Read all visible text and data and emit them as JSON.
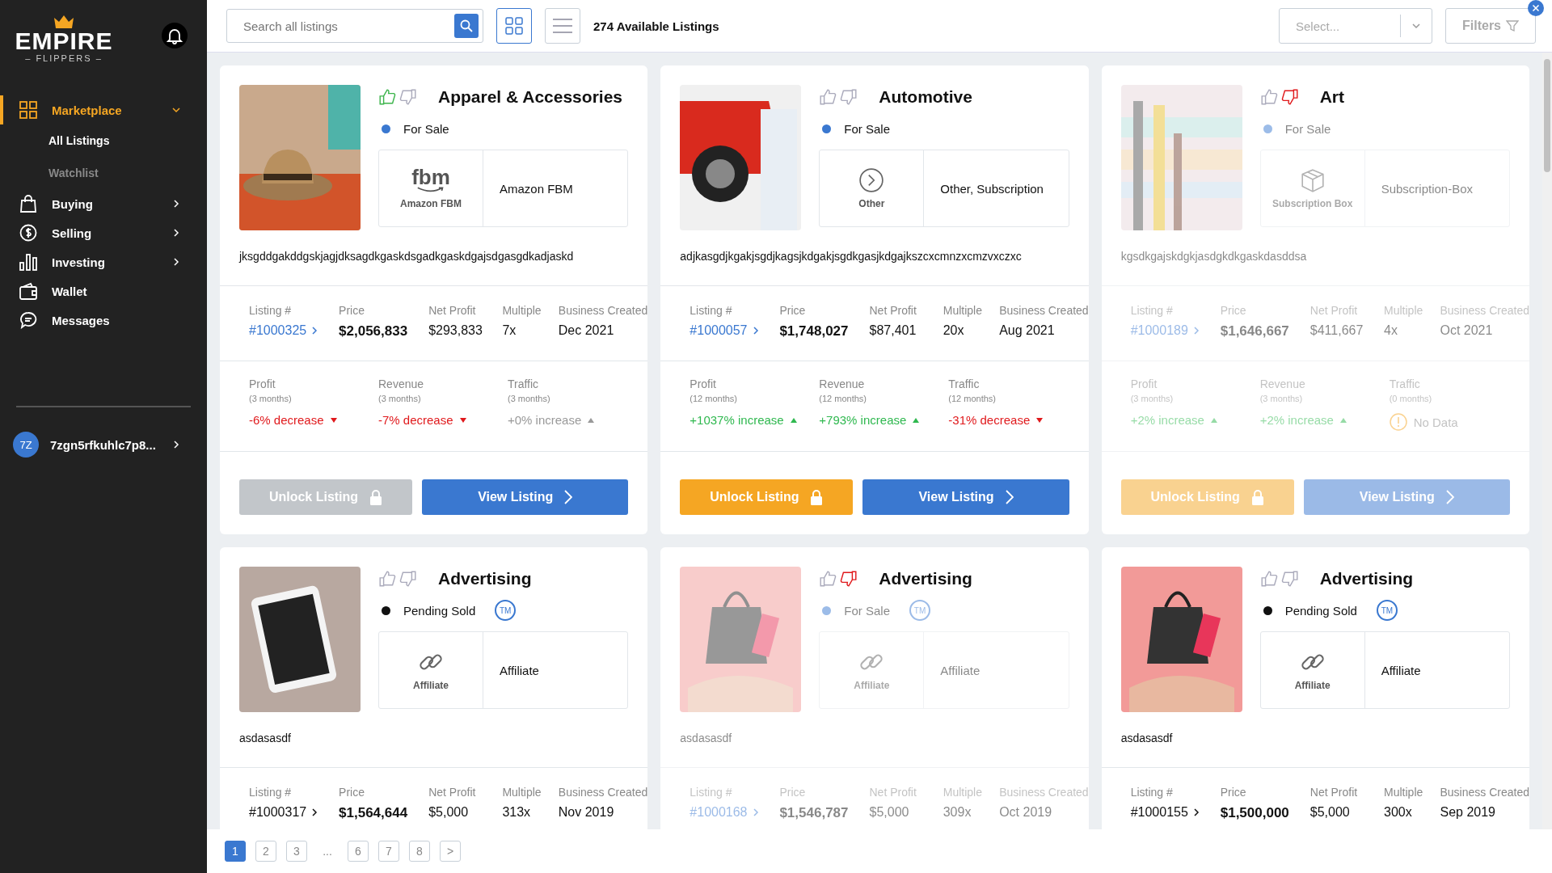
{
  "sidebar": {
    "logo": {
      "word": "EMPIRE",
      "sub": "– FLIPPERS –"
    },
    "nav": [
      {
        "label": "Marketplace",
        "selected": true,
        "expanded": true,
        "children": [
          {
            "label": "All Listings",
            "selected": true
          },
          {
            "label": "Watchlist",
            "selected": false
          }
        ]
      },
      {
        "label": "Buying",
        "selected": false,
        "expanded": false
      },
      {
        "label": "Selling",
        "selected": false,
        "expanded": false
      },
      {
        "label": "Investing",
        "selected": false,
        "expanded": false
      },
      {
        "label": "Wallet",
        "selected": false
      },
      {
        "label": "Messages",
        "selected": false
      }
    ],
    "user": {
      "initials": "7Z",
      "name": "7zgn5rfkuhlc7p8..."
    }
  },
  "toolbar": {
    "search": {
      "placeholder": "Search all listings"
    },
    "views": [
      {
        "kind": "grid",
        "selected": true
      },
      {
        "kind": "list",
        "selected": false
      }
    ],
    "count": "274 Available Listings",
    "select": {
      "placeholder": "Select..."
    },
    "filters": "Filters"
  },
  "listings": [
    {
      "category": "Apparel & Accessories",
      "thumbs_up": true,
      "thumbs_down": false,
      "faded": false,
      "status": {
        "label": "For Sale",
        "color": "#3a78d0"
      },
      "type": {
        "kind": "fbm",
        "logo": "fbm",
        "label": "Amazon FBM"
      },
      "monetization": "Amazon FBM",
      "description": "jksgddgakddgskjagjdksagdkgaskdsgadkgaskdgajsdgasgdkadjaskd",
      "stats": [
        {
          "kind": "listing",
          "label": "Listing #",
          "value": "#1000325",
          "linked": true
        },
        {
          "kind": "price",
          "label": "Price",
          "value": "$2,056,833"
        },
        {
          "kind": "net",
          "label": "Net Profit",
          "value": "$293,833"
        },
        {
          "kind": "multiple",
          "label": "Multiple",
          "value": "7x"
        },
        {
          "kind": "created",
          "label": "Business Created",
          "value": "Dec 2021"
        }
      ],
      "trends": [
        {
          "label": "Profit",
          "period": "(3 months)",
          "kind": "down",
          "value": "-6% decrease"
        },
        {
          "label": "Revenue",
          "period": "(3 months)",
          "kind": "down",
          "value": "-7% decrease"
        },
        {
          "label": "Traffic",
          "period": "(3 months)",
          "kind": "flat",
          "value": "+0% increase"
        }
      ],
      "unlock": "Unlock Listing",
      "unlock_disabled": true,
      "view": "View Listing"
    },
    {
      "category": "Automotive",
      "thumbs_up": false,
      "thumbs_down": false,
      "faded": false,
      "status": {
        "label": "For Sale",
        "color": "#3a78d0"
      },
      "type": {
        "kind": "other",
        "label": "Other"
      },
      "monetization": "Other, Subscription",
      "description": "adjkasgdjkgakjsgdjkagsjkdgakjsgdkgasjkdgajkszcxcmnzxcmzvxczxc",
      "stats": [
        {
          "kind": "listing",
          "label": "Listing #",
          "value": "#1000057",
          "linked": true
        },
        {
          "kind": "price",
          "label": "Price",
          "value": "$1,748,027"
        },
        {
          "kind": "net",
          "label": "Net Profit",
          "value": "$87,401"
        },
        {
          "kind": "multiple",
          "label": "Multiple",
          "value": "20x"
        },
        {
          "kind": "created",
          "label": "Business Created",
          "value": "Aug 2021"
        }
      ],
      "trends": [
        {
          "label": "Profit",
          "period": "(12 months)",
          "kind": "up",
          "value": "+1037% increase"
        },
        {
          "label": "Revenue",
          "period": "(12 months)",
          "kind": "up",
          "value": "+793% increase"
        },
        {
          "label": "Traffic",
          "period": "(12 months)",
          "kind": "down",
          "value": "-31% decrease"
        }
      ],
      "unlock": "Unlock Listing",
      "unlock_disabled": false,
      "view": "View Listing"
    },
    {
      "category": "Art",
      "thumbs_up": false,
      "thumbs_down": true,
      "faded": true,
      "status": {
        "label": "For Sale",
        "color": "#9cbce8"
      },
      "type": {
        "kind": "box",
        "label": "Subscription Box"
      },
      "monetization": "Subscription-Box",
      "description": "kgsdkgajskdgkjasdgkdkgaskdasddsa",
      "stats": [
        {
          "kind": "listing",
          "label": "Listing #",
          "value": "#1000189",
          "linked": true
        },
        {
          "kind": "price",
          "label": "Price",
          "value": "$1,646,667"
        },
        {
          "kind": "net",
          "label": "Net Profit",
          "value": "$411,667"
        },
        {
          "kind": "multiple",
          "label": "Multiple",
          "value": "4x"
        },
        {
          "kind": "created",
          "label": "Business Created",
          "value": "Oct 2021"
        }
      ],
      "trends": [
        {
          "label": "Profit",
          "period": "(3 months)",
          "kind": "up",
          "value": "+2% increase"
        },
        {
          "label": "Revenue",
          "period": "(3 months)",
          "kind": "up",
          "value": "+2% increase"
        },
        {
          "label": "Traffic",
          "period": "(0 months)",
          "kind": "nodata",
          "value": "No Data"
        }
      ],
      "unlock": "Unlock Listing",
      "unlock_disabled": false,
      "view": "View Listing"
    },
    {
      "category": "Advertising",
      "thumbs_up": false,
      "thumbs_down": false,
      "faded": false,
      "status": {
        "label": "Pending Sold",
        "color": "#111111"
      },
      "tm": "TM",
      "type": {
        "kind": "link",
        "label": "Affiliate"
      },
      "monetization": "Affiliate",
      "description": "asdasasdf",
      "stats": [
        {
          "kind": "listing",
          "label": "Listing #",
          "value": "#1000317",
          "linked": false
        },
        {
          "kind": "price",
          "label": "Price",
          "value": "$1,564,644"
        },
        {
          "kind": "net",
          "label": "Net Profit",
          "value": "$5,000"
        },
        {
          "kind": "multiple",
          "label": "Multiple",
          "value": "313x"
        },
        {
          "kind": "created",
          "label": "Business Created",
          "value": "Nov 2019"
        }
      ]
    },
    {
      "category": "Advertising",
      "thumbs_up": false,
      "thumbs_down": true,
      "faded": true,
      "status": {
        "label": "For Sale",
        "color": "#9cbce8"
      },
      "tm": "TM",
      "type": {
        "kind": "link",
        "label": "Affiliate"
      },
      "monetization": "Affiliate",
      "description": "asdasasdf",
      "stats": [
        {
          "kind": "listing",
          "label": "Listing #",
          "value": "#1000168",
          "linked": true
        },
        {
          "kind": "price",
          "label": "Price",
          "value": "$1,546,787"
        },
        {
          "kind": "net",
          "label": "Net Profit",
          "value": "$5,000"
        },
        {
          "kind": "multiple",
          "label": "Multiple",
          "value": "309x"
        },
        {
          "kind": "created",
          "label": "Business Created",
          "value": "Oct 2019"
        }
      ]
    },
    {
      "category": "Advertising",
      "thumbs_up": false,
      "thumbs_down": false,
      "faded": false,
      "status": {
        "label": "Pending Sold",
        "color": "#111111"
      },
      "tm": "TM",
      "type": {
        "kind": "link",
        "label": "Affiliate"
      },
      "monetization": "Affiliate",
      "description": "asdasasdf",
      "stats": [
        {
          "kind": "listing",
          "label": "Listing #",
          "value": "#1000155",
          "linked": false
        },
        {
          "kind": "price",
          "label": "Price",
          "value": "$1,500,000"
        },
        {
          "kind": "net",
          "label": "Net Profit",
          "value": "$5,000"
        },
        {
          "kind": "multiple",
          "label": "Multiple",
          "value": "300x"
        },
        {
          "kind": "created",
          "label": "Business Created",
          "value": "Sep 2019"
        }
      ]
    }
  ],
  "pagination": [
    {
      "label": "1",
      "selected": true
    },
    {
      "label": "2",
      "selected": false
    },
    {
      "label": "3",
      "selected": false
    },
    {
      "label": "...",
      "kind": "gap"
    },
    {
      "label": "6",
      "selected": false
    },
    {
      "label": "7",
      "selected": false
    },
    {
      "label": "8",
      "selected": false
    },
    {
      "label": ">",
      "selected": false
    }
  ]
}
